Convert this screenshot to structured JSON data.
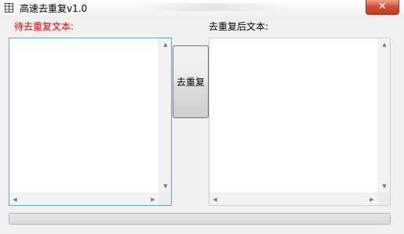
{
  "window": {
    "title": "高速去重复v1.0",
    "close_glyph": "✕"
  },
  "source": {
    "label": "待去重复文本:",
    "text": ""
  },
  "result": {
    "label": "去重复后文本:",
    "text": ""
  },
  "actions": {
    "dedupe_label": "去重复"
  },
  "progress": {
    "value": 0
  },
  "scrollbar": {
    "up": "▲",
    "down": "▼",
    "left": "◀",
    "right": "▶"
  },
  "colors": {
    "source_label": "#e00000",
    "result_label": "#000000",
    "source_box_border": "#6ca0d8",
    "close_button": "#c63a21"
  },
  "icons": {
    "app": "table-icon",
    "close": "close-icon"
  }
}
